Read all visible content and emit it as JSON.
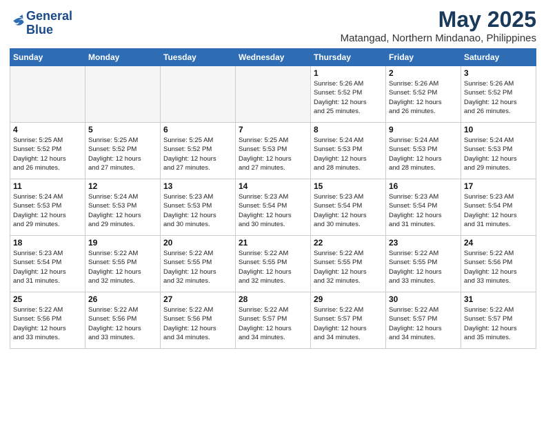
{
  "header": {
    "logo_line1": "General",
    "logo_line2": "Blue",
    "title": "May 2025",
    "subtitle": "Matangad, Northern Mindanao, Philippines"
  },
  "days_of_week": [
    "Sunday",
    "Monday",
    "Tuesday",
    "Wednesday",
    "Thursday",
    "Friday",
    "Saturday"
  ],
  "weeks": [
    [
      {
        "day": "",
        "info": ""
      },
      {
        "day": "",
        "info": ""
      },
      {
        "day": "",
        "info": ""
      },
      {
        "day": "",
        "info": ""
      },
      {
        "day": "1",
        "info": "Sunrise: 5:26 AM\nSunset: 5:52 PM\nDaylight: 12 hours\nand 25 minutes."
      },
      {
        "day": "2",
        "info": "Sunrise: 5:26 AM\nSunset: 5:52 PM\nDaylight: 12 hours\nand 26 minutes."
      },
      {
        "day": "3",
        "info": "Sunrise: 5:26 AM\nSunset: 5:52 PM\nDaylight: 12 hours\nand 26 minutes."
      }
    ],
    [
      {
        "day": "4",
        "info": "Sunrise: 5:25 AM\nSunset: 5:52 PM\nDaylight: 12 hours\nand 26 minutes."
      },
      {
        "day": "5",
        "info": "Sunrise: 5:25 AM\nSunset: 5:52 PM\nDaylight: 12 hours\nand 27 minutes."
      },
      {
        "day": "6",
        "info": "Sunrise: 5:25 AM\nSunset: 5:52 PM\nDaylight: 12 hours\nand 27 minutes."
      },
      {
        "day": "7",
        "info": "Sunrise: 5:25 AM\nSunset: 5:53 PM\nDaylight: 12 hours\nand 27 minutes."
      },
      {
        "day": "8",
        "info": "Sunrise: 5:24 AM\nSunset: 5:53 PM\nDaylight: 12 hours\nand 28 minutes."
      },
      {
        "day": "9",
        "info": "Sunrise: 5:24 AM\nSunset: 5:53 PM\nDaylight: 12 hours\nand 28 minutes."
      },
      {
        "day": "10",
        "info": "Sunrise: 5:24 AM\nSunset: 5:53 PM\nDaylight: 12 hours\nand 29 minutes."
      }
    ],
    [
      {
        "day": "11",
        "info": "Sunrise: 5:24 AM\nSunset: 5:53 PM\nDaylight: 12 hours\nand 29 minutes."
      },
      {
        "day": "12",
        "info": "Sunrise: 5:24 AM\nSunset: 5:53 PM\nDaylight: 12 hours\nand 29 minutes."
      },
      {
        "day": "13",
        "info": "Sunrise: 5:23 AM\nSunset: 5:53 PM\nDaylight: 12 hours\nand 30 minutes."
      },
      {
        "day": "14",
        "info": "Sunrise: 5:23 AM\nSunset: 5:54 PM\nDaylight: 12 hours\nand 30 minutes."
      },
      {
        "day": "15",
        "info": "Sunrise: 5:23 AM\nSunset: 5:54 PM\nDaylight: 12 hours\nand 30 minutes."
      },
      {
        "day": "16",
        "info": "Sunrise: 5:23 AM\nSunset: 5:54 PM\nDaylight: 12 hours\nand 31 minutes."
      },
      {
        "day": "17",
        "info": "Sunrise: 5:23 AM\nSunset: 5:54 PM\nDaylight: 12 hours\nand 31 minutes."
      }
    ],
    [
      {
        "day": "18",
        "info": "Sunrise: 5:23 AM\nSunset: 5:54 PM\nDaylight: 12 hours\nand 31 minutes."
      },
      {
        "day": "19",
        "info": "Sunrise: 5:22 AM\nSunset: 5:55 PM\nDaylight: 12 hours\nand 32 minutes."
      },
      {
        "day": "20",
        "info": "Sunrise: 5:22 AM\nSunset: 5:55 PM\nDaylight: 12 hours\nand 32 minutes."
      },
      {
        "day": "21",
        "info": "Sunrise: 5:22 AM\nSunset: 5:55 PM\nDaylight: 12 hours\nand 32 minutes."
      },
      {
        "day": "22",
        "info": "Sunrise: 5:22 AM\nSunset: 5:55 PM\nDaylight: 12 hours\nand 32 minutes."
      },
      {
        "day": "23",
        "info": "Sunrise: 5:22 AM\nSunset: 5:55 PM\nDaylight: 12 hours\nand 33 minutes."
      },
      {
        "day": "24",
        "info": "Sunrise: 5:22 AM\nSunset: 5:56 PM\nDaylight: 12 hours\nand 33 minutes."
      }
    ],
    [
      {
        "day": "25",
        "info": "Sunrise: 5:22 AM\nSunset: 5:56 PM\nDaylight: 12 hours\nand 33 minutes."
      },
      {
        "day": "26",
        "info": "Sunrise: 5:22 AM\nSunset: 5:56 PM\nDaylight: 12 hours\nand 33 minutes."
      },
      {
        "day": "27",
        "info": "Sunrise: 5:22 AM\nSunset: 5:56 PM\nDaylight: 12 hours\nand 34 minutes."
      },
      {
        "day": "28",
        "info": "Sunrise: 5:22 AM\nSunset: 5:57 PM\nDaylight: 12 hours\nand 34 minutes."
      },
      {
        "day": "29",
        "info": "Sunrise: 5:22 AM\nSunset: 5:57 PM\nDaylight: 12 hours\nand 34 minutes."
      },
      {
        "day": "30",
        "info": "Sunrise: 5:22 AM\nSunset: 5:57 PM\nDaylight: 12 hours\nand 34 minutes."
      },
      {
        "day": "31",
        "info": "Sunrise: 5:22 AM\nSunset: 5:57 PM\nDaylight: 12 hours\nand 35 minutes."
      }
    ]
  ]
}
